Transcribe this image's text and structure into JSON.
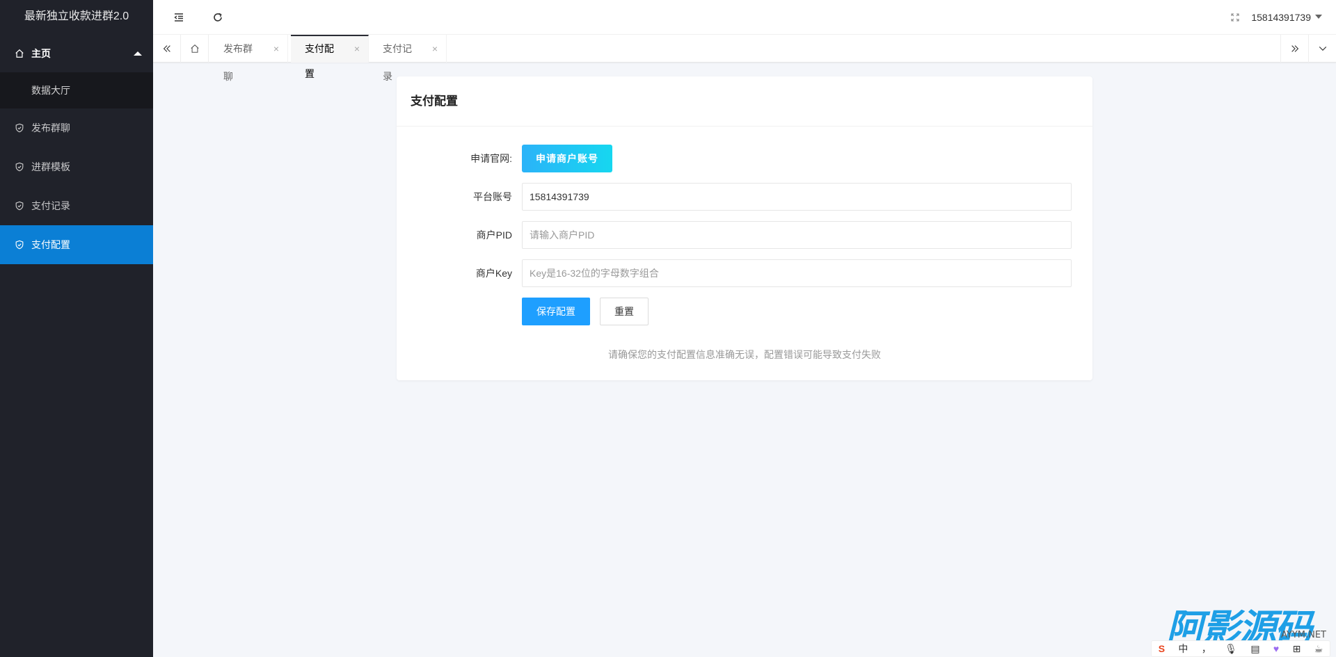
{
  "app": {
    "title": "最新独立收款进群2.0"
  },
  "sidebar": {
    "home": {
      "label": "主页"
    },
    "home_sub": [
      {
        "label": "数据大厅"
      }
    ],
    "items": [
      {
        "label": "发布群聊"
      },
      {
        "label": "进群模板"
      },
      {
        "label": "支付记录"
      },
      {
        "label": "支付配置"
      }
    ],
    "active": "支付配置"
  },
  "header": {
    "user": "15814391739"
  },
  "tabs": [
    {
      "label": "发布群聊",
      "close": "×"
    },
    {
      "label": "支付配置",
      "close": "×"
    },
    {
      "label": "支付记录",
      "close": "×"
    }
  ],
  "card": {
    "title": "支付配置",
    "apply": {
      "label": "申请官网:",
      "button": "申请商户账号"
    },
    "account": {
      "label": "平台账号",
      "value": "15814391739"
    },
    "pid": {
      "label": "商户PID",
      "placeholder": "请输入商户PID"
    },
    "key": {
      "label": "商户Key",
      "placeholder": "Key是16-32位的字母数字组合"
    },
    "save": "保存配置",
    "reset": "重置",
    "tip": "请确保您的支付配置信息准确无误，配置错误可能导致支付失败"
  },
  "watermark": {
    "text": "阿影源码",
    "sub": "AYYM.NET"
  },
  "ime": {
    "items": [
      "S",
      "中",
      "，",
      "🎙",
      "▤",
      "♥",
      "⊞",
      "☕"
    ]
  },
  "colors": {
    "sidebar_bg": "#20222a",
    "active": "#0b7fd5",
    "primary": "#1e9fff"
  }
}
